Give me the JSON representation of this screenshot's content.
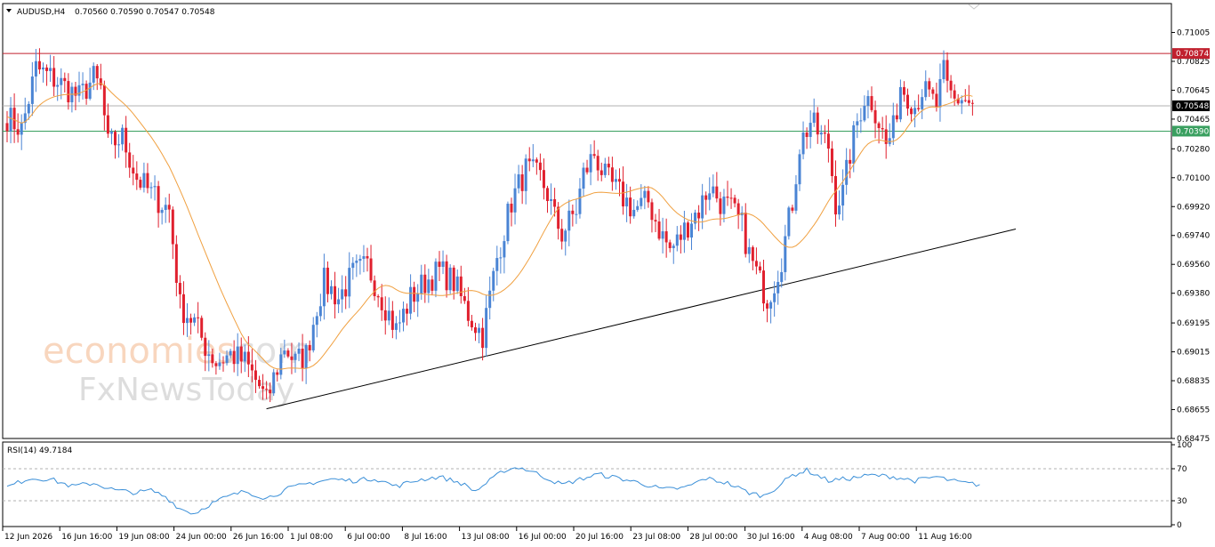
{
  "header": {
    "symbol": "AUDUSD,H4",
    "ohlc": "0.70560 0.70590 0.70547 0.70548"
  },
  "rsi_header": "RSI(14) 49.7184",
  "watermark": {
    "brand_a": "economies",
    "brand_b": ".com",
    "brand_c": "FxNewsToday"
  },
  "colors": {
    "bull": "#4a84d4",
    "bear": "#e0202e",
    "ma": "#f0a040",
    "rsi": "#3a8fd8",
    "resistance": "#c0202e",
    "support": "#3aa060",
    "current": "#b0b0b0",
    "trendline": "#000000",
    "frame": "#000000"
  },
  "chart_data": [
    {
      "type": "candlestick",
      "title": "",
      "ylim": [
        0.68475,
        0.71185
      ],
      "y_ticks": [
        "0.71005",
        "0.70825",
        "0.70645",
        "0.70465",
        "0.70280",
        "0.70100",
        "0.69920",
        "0.69740",
        "0.69560",
        "0.69380",
        "0.69195",
        "0.69015",
        "0.68835",
        "0.68655",
        "0.68475"
      ],
      "x_ticks": [
        "12 Jun 2026",
        "16 Jun 16:00",
        "19 Jun 08:00",
        "24 Jun 00:00",
        "26 Jun 16:00",
        "1 Jul 08:00",
        "6 Jul 00:00",
        "8 Jul 16:00",
        "13 Jul 08:00",
        "16 Jul 00:00",
        "20 Jul 16:00",
        "23 Jul 08:00",
        "28 Jul 00:00",
        "30 Jul 16:00",
        "4 Aug 08:00",
        "7 Aug 00:00",
        "11 Aug 16:00"
      ],
      "close_anchors": [
        [
          0,
          0.7048
        ],
        [
          4,
          0.704
        ],
        [
          8,
          0.7078
        ],
        [
          14,
          0.707
        ],
        [
          20,
          0.706
        ],
        [
          24,
          0.7072
        ],
        [
          26,
          0.7065
        ],
        [
          28,
          0.703
        ],
        [
          32,
          0.7035
        ],
        [
          36,
          0.701
        ],
        [
          40,
          0.7
        ],
        [
          45,
          0.699
        ],
        [
          48,
          0.693
        ],
        [
          52,
          0.692
        ],
        [
          55,
          0.6905
        ],
        [
          58,
          0.6895
        ],
        [
          62,
          0.69
        ],
        [
          66,
          0.6895
        ],
        [
          70,
          0.688
        ],
        [
          72,
          0.687
        ],
        [
          74,
          0.6885
        ],
        [
          77,
          0.6905
        ],
        [
          80,
          0.6895
        ],
        [
          83,
          0.69
        ],
        [
          86,
          0.693
        ],
        [
          88,
          0.6945
        ],
        [
          92,
          0.6935
        ],
        [
          96,
          0.695
        ],
        [
          100,
          0.6955
        ],
        [
          104,
          0.6935
        ],
        [
          108,
          0.6915
        ],
        [
          112,
          0.6935
        ],
        [
          116,
          0.6945
        ],
        [
          120,
          0.6952
        ],
        [
          124,
          0.6945
        ],
        [
          126,
          0.6935
        ],
        [
          128,
          0.6925
        ],
        [
          132,
          0.6912
        ],
        [
          136,
          0.696
        ],
        [
          140,
          0.6995
        ],
        [
          144,
          0.7015
        ],
        [
          148,
          0.701
        ],
        [
          150,
          0.7
        ],
        [
          152,
          0.6985
        ],
        [
          154,
          0.6975
        ],
        [
          158,
          0.699
        ],
        [
          160,
          0.7012
        ],
        [
          163,
          0.7025
        ],
        [
          166,
          0.701
        ],
        [
          170,
          0.7
        ],
        [
          174,
          0.699
        ],
        [
          178,
          0.6995
        ],
        [
          181,
          0.6978
        ],
        [
          184,
          0.6965
        ],
        [
          186,
          0.697
        ],
        [
          190,
          0.6985
        ],
        [
          192,
          0.699
        ],
        [
          195,
          0.7005
        ],
        [
          198,
          0.6995
        ],
        [
          201,
          0.699
        ],
        [
          204,
          0.698
        ],
        [
          206,
          0.6962
        ],
        [
          209,
          0.6945
        ],
        [
          211,
          0.6935
        ],
        [
          213,
          0.6945
        ],
        [
          215,
          0.696
        ],
        [
          218,
          0.6995
        ],
        [
          220,
          0.703
        ],
        [
          223,
          0.7045
        ],
        [
          226,
          0.7035
        ],
        [
          228,
          0.703
        ],
        [
          230,
          0.6995
        ],
        [
          232,
          0.7
        ],
        [
          234,
          0.7025
        ],
        [
          236,
          0.7045
        ],
        [
          238,
          0.706
        ],
        [
          240,
          0.7058
        ],
        [
          242,
          0.7045
        ],
        [
          244,
          0.703
        ],
        [
          246,
          0.704
        ],
        [
          248,
          0.7068
        ],
        [
          250,
          0.7062
        ],
        [
          252,
          0.7055
        ],
        [
          254,
          0.7065
        ],
        [
          256,
          0.706
        ],
        [
          258,
          0.7055
        ],
        [
          260,
          0.7075
        ],
        [
          261,
          0.7065
        ],
        [
          263,
          0.7058
        ],
        [
          265,
          0.706
        ],
        [
          268,
          0.7055
        ]
      ],
      "levels": {
        "resistance": 0.70874,
        "current": 0.70548,
        "support": 0.7039
      },
      "level_labels": {
        "resistance": "0.70874",
        "current": "0.70548",
        "support": "0.70390"
      },
      "trendline": [
        [
          72,
          0.6866
        ],
        [
          280,
          0.6978
        ]
      ],
      "ma_period": 20
    },
    {
      "type": "line",
      "title": "RSI(14) 49.7184",
      "ylim": [
        0,
        100
      ],
      "y_ticks": [
        "100",
        "70",
        "30",
        "0"
      ],
      "levels": [
        70,
        30
      ],
      "anchors": [
        [
          0,
          47
        ],
        [
          6,
          58
        ],
        [
          12,
          57
        ],
        [
          18,
          48
        ],
        [
          24,
          52
        ],
        [
          30,
          43
        ],
        [
          36,
          40
        ],
        [
          40,
          43
        ],
        [
          44,
          35
        ],
        [
          48,
          20
        ],
        [
          52,
          14
        ],
        [
          56,
          25
        ],
        [
          60,
          33
        ],
        [
          66,
          42
        ],
        [
          72,
          33
        ],
        [
          78,
          45
        ],
        [
          84,
          52
        ],
        [
          90,
          57
        ],
        [
          96,
          55
        ],
        [
          102,
          58
        ],
        [
          108,
          48
        ],
        [
          114,
          56
        ],
        [
          120,
          60
        ],
        [
          126,
          52
        ],
        [
          130,
          42
        ],
        [
          134,
          55
        ],
        [
          138,
          68
        ],
        [
          142,
          72
        ],
        [
          146,
          66
        ],
        [
          150,
          58
        ],
        [
          154,
          50
        ],
        [
          160,
          58
        ],
        [
          164,
          63
        ],
        [
          170,
          58
        ],
        [
          176,
          52
        ],
        [
          182,
          44
        ],
        [
          188,
          46
        ],
        [
          194,
          58
        ],
        [
          200,
          52
        ],
        [
          206,
          40
        ],
        [
          210,
          36
        ],
        [
          214,
          48
        ],
        [
          218,
          62
        ],
        [
          222,
          68
        ],
        [
          228,
          55
        ],
        [
          234,
          58
        ],
        [
          240,
          62
        ],
        [
          246,
          60
        ],
        [
          252,
          55
        ],
        [
          258,
          60
        ],
        [
          262,
          55
        ],
        [
          266,
          52
        ],
        [
          270,
          50
        ]
      ]
    }
  ]
}
